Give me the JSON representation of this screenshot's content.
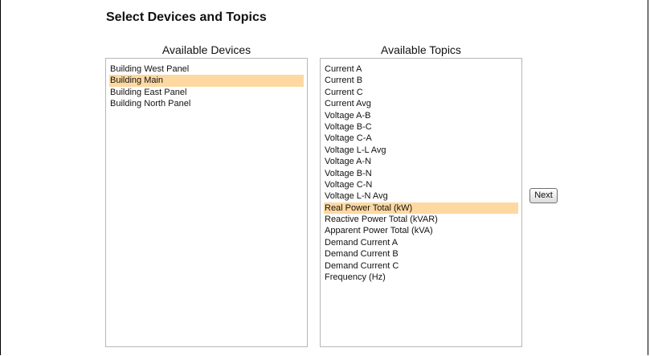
{
  "page": {
    "title": "Select Devices and Topics"
  },
  "devices": {
    "heading": "Available Devices",
    "items": [
      {
        "label": "Building West Panel",
        "selected": false
      },
      {
        "label": "Building Main",
        "selected": true
      },
      {
        "label": "Building East Panel",
        "selected": false
      },
      {
        "label": "Building North Panel",
        "selected": false
      }
    ]
  },
  "topics": {
    "heading": "Available Topics",
    "items": [
      {
        "label": "Current A",
        "selected": false
      },
      {
        "label": "Current B",
        "selected": false
      },
      {
        "label": "Current C",
        "selected": false
      },
      {
        "label": "Current Avg",
        "selected": false
      },
      {
        "label": "Voltage A-B",
        "selected": false
      },
      {
        "label": "Voltage B-C",
        "selected": false
      },
      {
        "label": "Voltage C-A",
        "selected": false
      },
      {
        "label": "Voltage L-L Avg",
        "selected": false
      },
      {
        "label": "Voltage A-N",
        "selected": false
      },
      {
        "label": "Voltage B-N",
        "selected": false
      },
      {
        "label": "Voltage C-N",
        "selected": false
      },
      {
        "label": "Voltage L-N Avg",
        "selected": false
      },
      {
        "label": "Real Power Total (kW)",
        "selected": true
      },
      {
        "label": "Reactive Power Total (kVAR)",
        "selected": false
      },
      {
        "label": "Apparent Power Total (kVA)",
        "selected": false
      },
      {
        "label": "Demand Current A",
        "selected": false
      },
      {
        "label": "Demand Current B",
        "selected": false
      },
      {
        "label": "Demand Current C",
        "selected": false
      },
      {
        "label": "Frequency (Hz)",
        "selected": false
      }
    ]
  },
  "actions": {
    "next_label": "Next"
  },
  "colors": {
    "selection": "#fdd9a1",
    "list_border": "#b7b7b7"
  }
}
